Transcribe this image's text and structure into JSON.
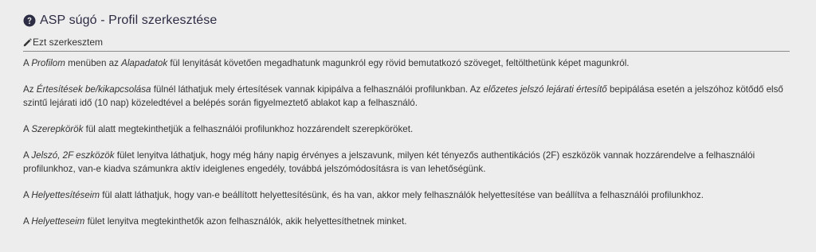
{
  "header": {
    "title": "ASP súgó - Profil szerkesztése",
    "edit_label": "Ezt szerkesztem"
  },
  "paragraphs": {
    "p1": {
      "a": "A ",
      "b": "Profilom",
      "c": " menüben az ",
      "d": "Alapadatok",
      "e": " fül lenyitását követően megadhatunk magunkról egy rövid bemutatkozó szöveget, feltölthetünk képet magunkról."
    },
    "p2": {
      "a": "Az ",
      "b": "Értesítések be/kikapcsolása",
      "c": " fülnél láthatjuk mely értesítések vannak kipipálva a felhasználói profilunkban. Az ",
      "d": "előzetes jelszó lejárati értesítő",
      "e": " bepipálása esetén a jelszóhoz kötődő első szintű lejárati idő (10 nap) közeledtével a belépés során figyelmeztető ablakot kap a felhasználó."
    },
    "p3": {
      "a": "A ",
      "b": "Szerepkörök",
      "c": " fül alatt megtekinthetjük a felhasználói profilunkhoz hozzárendelt szerepköröket."
    },
    "p4": {
      "a": "A ",
      "b": "Jelszó, 2F eszközök",
      "c": " fület lenyitva láthatjuk, hogy még hány napig érvényes a jelszavunk, milyen két tényezős authentikációs (2F) eszközök vannak hozzárendelve a felhasználói profilunkhoz, van-e kiadva számunkra aktív ideiglenes engedély, továbbá jelszómódosításra is van lehetőségünk."
    },
    "p5": {
      "a": "A ",
      "b": "Helyettesítéseim",
      "c": " fül alatt láthatjuk, hogy van-e beállított helyettesítésünk, és ha van, akkor mely felhasználók helyettesítése van beállítva a felhasználói profilunkhoz."
    },
    "p6": {
      "a": "A ",
      "b": "Helyetteseim",
      "c": " fület lenyitva megtekinthetők azon felhasználók, akik helyettesíthetnek minket."
    }
  },
  "icons": {
    "help": "question-circle-icon",
    "edit": "pencil-icon"
  },
  "colors": {
    "background": "#ededed",
    "title": "#2c2c44",
    "text": "#333333",
    "rule": "#8a8a8a"
  }
}
